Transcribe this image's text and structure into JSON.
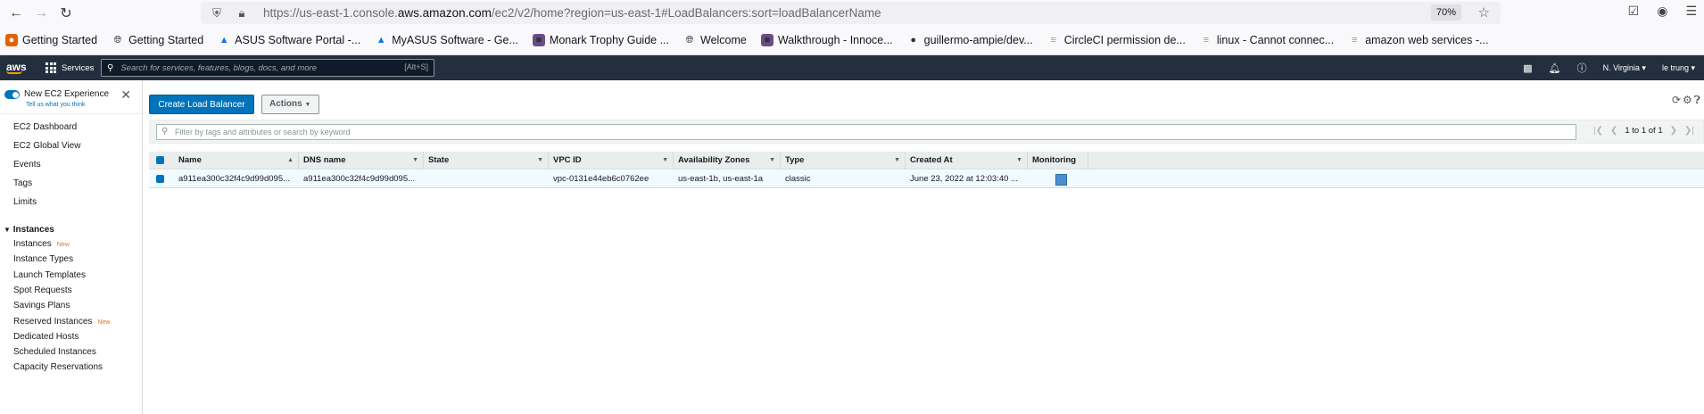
{
  "browser": {
    "url_prefix": "https://us-east-1.console.",
    "url_domain": "aws.amazon.com",
    "url_suffix": "/ec2/v2/home?region=us-east-1#LoadBalancers:sort=loadBalancerName",
    "zoom": "70%",
    "bookmarks": [
      {
        "label": "Getting Started",
        "icon": "firefox-icon"
      },
      {
        "label": "Getting Started",
        "icon": "globe-icon"
      },
      {
        "label": "ASUS Software Portal -...",
        "icon": "asus-icon"
      },
      {
        "label": "MyASUS Software - Ge...",
        "icon": "asus-icon"
      },
      {
        "label": "Monark Trophy Guide ...",
        "icon": "image-icon"
      },
      {
        "label": "Welcome",
        "icon": "globe-icon"
      },
      {
        "label": "Walkthrough - Innoce...",
        "icon": "image-icon"
      },
      {
        "label": "guillermo-ampie/dev...",
        "icon": "github-icon"
      },
      {
        "label": "CircleCI permission de...",
        "icon": "stackoverflow-icon"
      },
      {
        "label": "linux - Cannot connec...",
        "icon": "stackoverflow-icon"
      },
      {
        "label": "amazon web services -...",
        "icon": "stackoverflow-icon"
      }
    ]
  },
  "aws_nav": {
    "logo": "aws",
    "services": "Services",
    "search_placeholder": "Search for services, features, blogs, docs, and more",
    "search_shortcut": "[Alt+S]",
    "region": "N. Virginia ▾",
    "user": "le trung ▾"
  },
  "sidebar": {
    "experience_title": "New EC2 Experience",
    "experience_sub": "Tell us what you think",
    "items_top": [
      "EC2 Dashboard",
      "EC2 Global View",
      "Events",
      "Tags",
      "Limits"
    ],
    "section_instances": "Instances",
    "instances_items": [
      {
        "label": "Instances",
        "badge": "New"
      },
      {
        "label": "Instance Types",
        "badge": ""
      },
      {
        "label": "Launch Templates",
        "badge": ""
      },
      {
        "label": "Spot Requests",
        "badge": ""
      },
      {
        "label": "Savings Plans",
        "badge": ""
      },
      {
        "label": "Reserved Instances",
        "badge": "New"
      },
      {
        "label": "Dedicated Hosts",
        "badge": ""
      },
      {
        "label": "Scheduled Instances",
        "badge": ""
      },
      {
        "label": "Capacity Reservations",
        "badge": ""
      }
    ]
  },
  "main": {
    "create_button": "Create Load Balancer",
    "actions_button": "Actions",
    "filter_placeholder": "Filter by tags and attributes or search by keyword",
    "pagination": "1 to 1 of 1",
    "columns": [
      "Name",
      "DNS name",
      "State",
      "VPC ID",
      "Availability Zones",
      "Type",
      "Created At",
      "Monitoring"
    ],
    "rows": [
      {
        "name": "a911ea300c32f4c9d99d095...",
        "dns": "a911ea300c32f4c9d99d095...",
        "state": "",
        "vpc": "vpc-0131e44eb6c0762ee",
        "zones": "us-east-1b, us-east-1a",
        "type": "classic",
        "created": "June 23, 2022 at 12:03:40 ..."
      }
    ]
  },
  "colors": {
    "aws_nav_bg": "#232f3e",
    "primary": "#0073bb",
    "accent_orange": "#ff9900"
  }
}
